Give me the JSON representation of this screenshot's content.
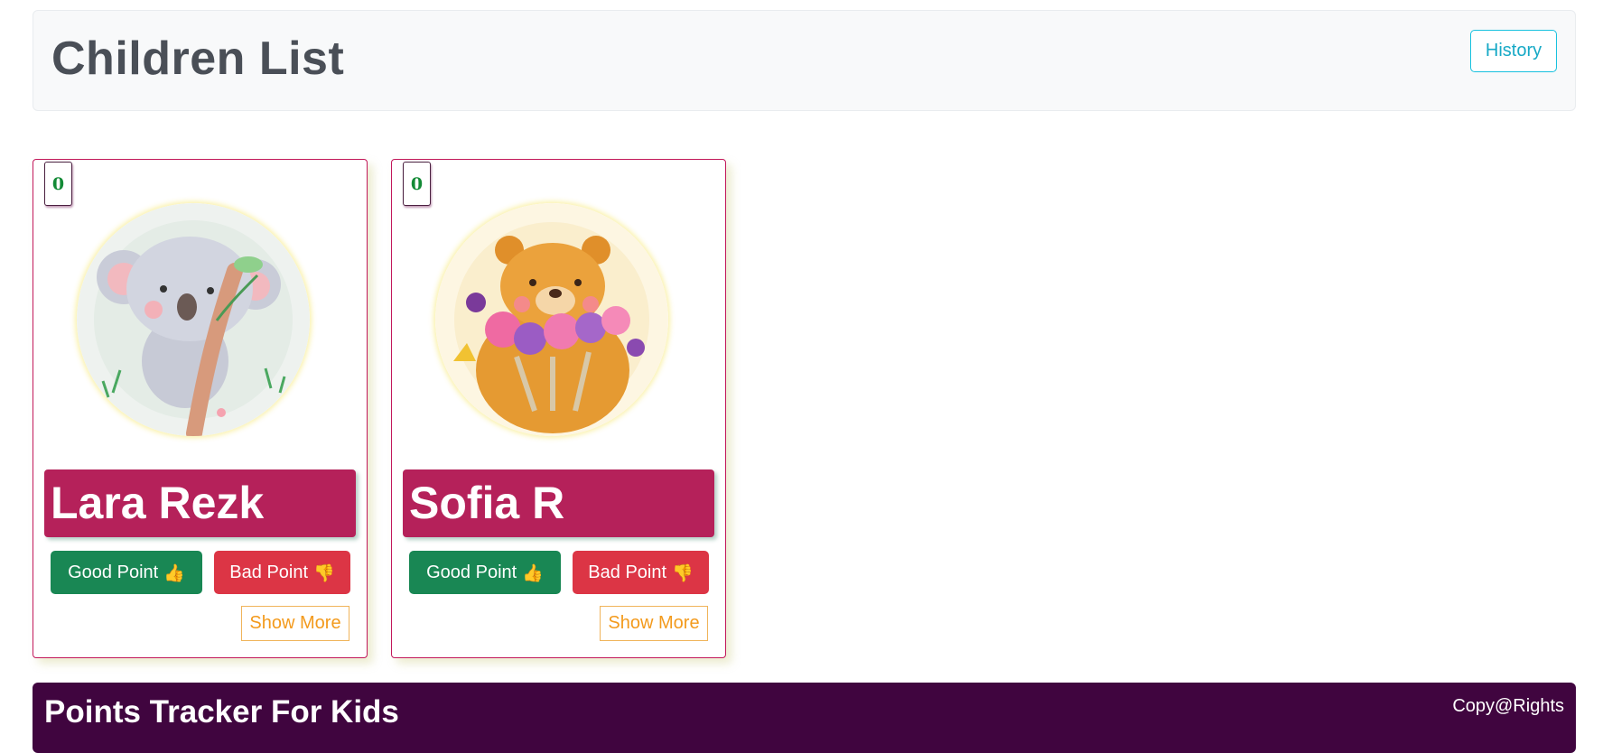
{
  "header": {
    "title": "Children List",
    "history_label": "History"
  },
  "children": [
    {
      "name": "Lara Rezk",
      "score": "0",
      "avatar": "koala-on-branch-illustration",
      "good_label": "Good Point",
      "good_icon": "👍",
      "bad_label": "Bad Point",
      "bad_icon": "👎",
      "show_more_label": "Show More"
    },
    {
      "name": "Sofia R",
      "score": "0",
      "avatar": "bear-with-flowers-illustration",
      "good_label": "Good Point",
      "good_icon": "👍",
      "bad_label": "Bad Point",
      "bad_icon": "👎",
      "show_more_label": "Show More"
    }
  ],
  "footer": {
    "title": "Points Tracker For Kids",
    "copyright": "Copy@Rights"
  },
  "colors": {
    "name_bar": "#b5215a",
    "good_button": "#198754",
    "bad_button": "#dc3545",
    "footer_bg": "#40053f",
    "history_outline": "#17c1de",
    "show_more_outline": "#f0b45a"
  }
}
